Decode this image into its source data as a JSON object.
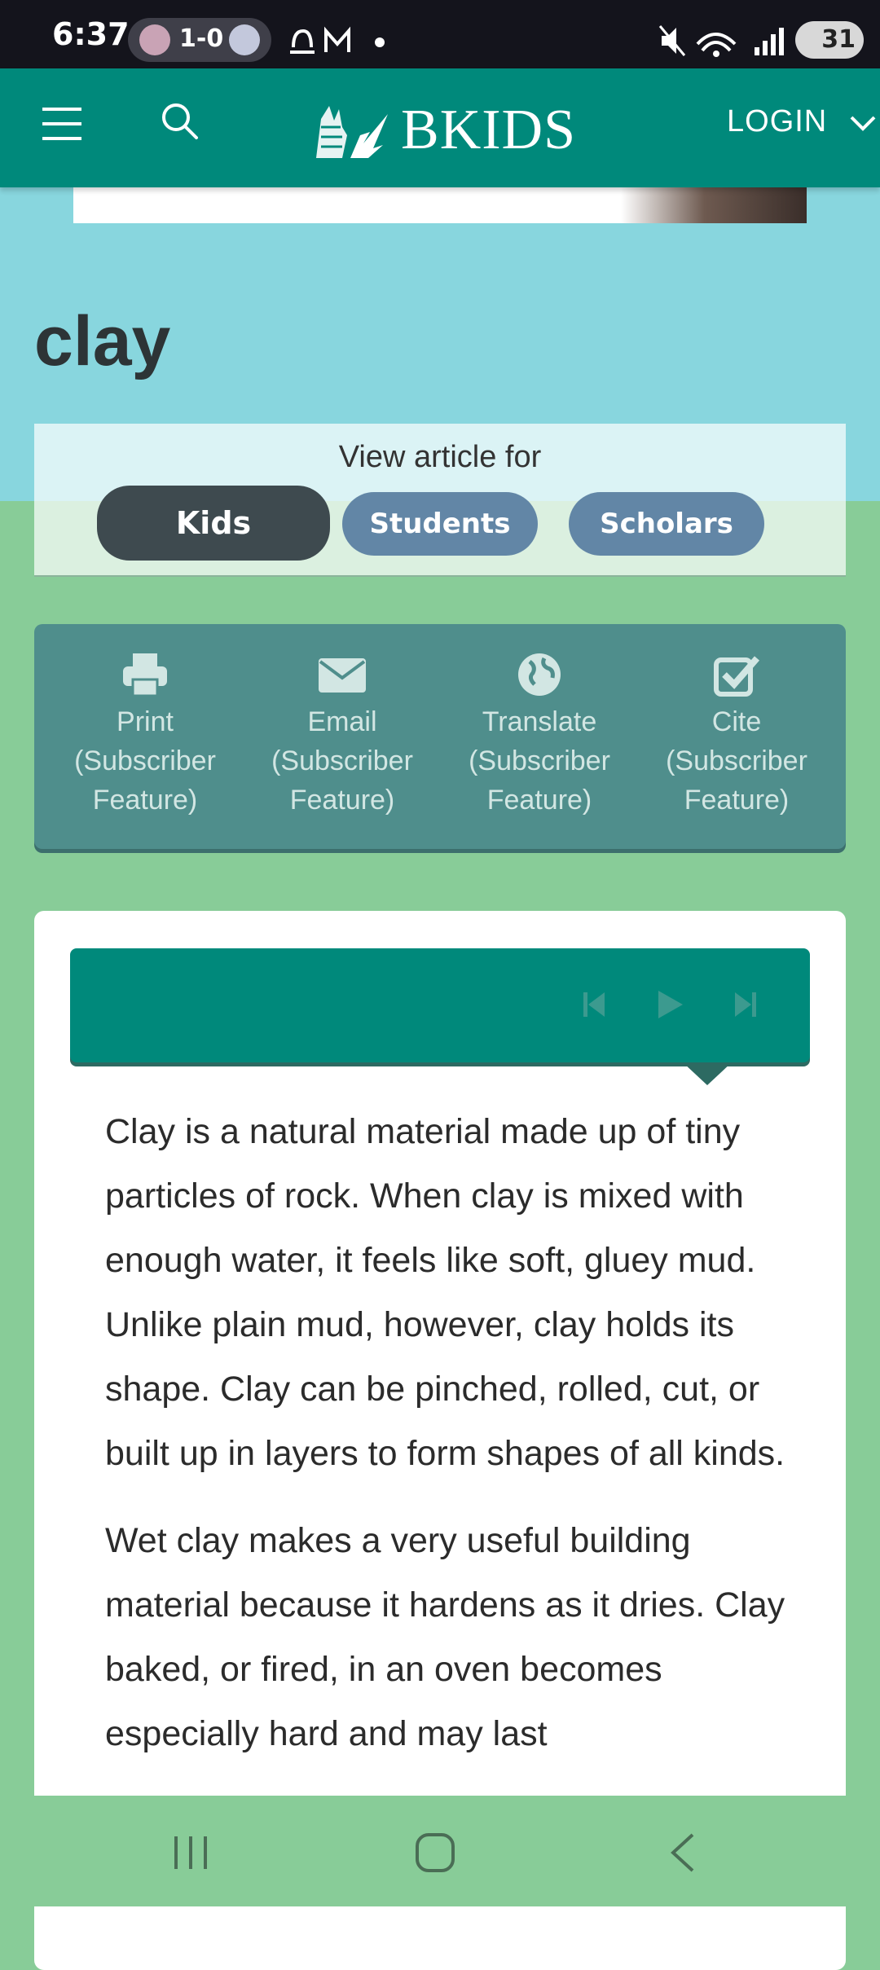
{
  "status_bar": {
    "time": "6:37",
    "score": "1-0",
    "battery": "31"
  },
  "header": {
    "logo_text": "BKIDS",
    "login_label": "LOGIN"
  },
  "page": {
    "title": "clay"
  },
  "view_for": {
    "label": "View article for",
    "levels": [
      "Kids",
      "Students",
      "Scholars"
    ],
    "selected": "Kids"
  },
  "tools": [
    {
      "label": "Print\n(Subscriber\nFeature)",
      "icon": "print-icon"
    },
    {
      "label": "Email\n(Subscriber\nFeature)",
      "icon": "email-icon"
    },
    {
      "label": "Translate\n(Subscriber\nFeature)",
      "icon": "globe-icon"
    },
    {
      "label": "Cite\n(Subscriber\nFeature)",
      "icon": "cite-check-icon"
    }
  ],
  "article": {
    "paragraphs": [
      "Clay is a natural material made up of tiny particles of rock. When clay is mixed with enough water, it feels like soft, gluey mud. Unlike plain mud, however, clay holds its shape. Clay can be pinched, rolled, cut, or built up in layers to form shapes of all kinds.",
      "Wet clay makes a very useful building material because it hardens as it dries. Clay baked, or fired, in an oven becomes especially hard and may last"
    ]
  },
  "colors": {
    "header": "#00897b",
    "hero": "#88d6de",
    "page_bg": "#88cc98",
    "kids_button": "#3e4a4f",
    "level_button": "#6286a6",
    "tools_bg": "#4f8e8c"
  }
}
